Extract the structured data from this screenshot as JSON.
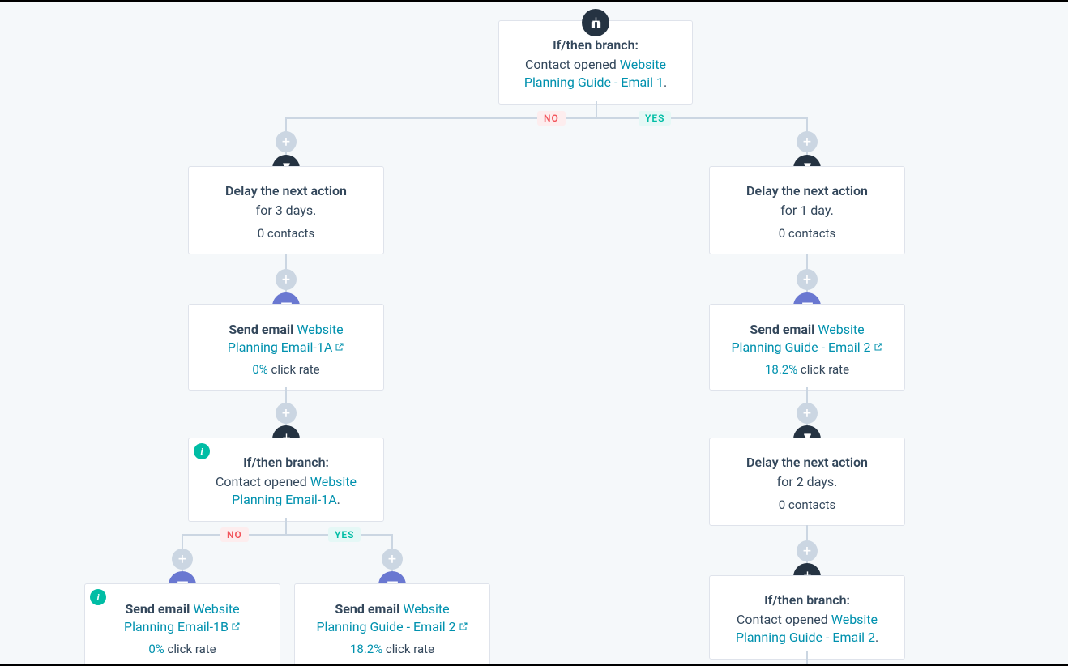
{
  "root_branch": {
    "title": "If/then branch:",
    "pre": "Contact opened ",
    "link": "Website Planning Guide - Email 1",
    "post": "."
  },
  "tag_no": "NO",
  "tag_yes": "YES",
  "left": {
    "delay": {
      "title": "Delay the next action",
      "body": "for 3 days.",
      "sub": "0 contacts"
    },
    "email": {
      "pre": "Send email ",
      "link": "Website Planning Email-1A",
      "pct": "0%",
      "rate_label": " click rate"
    },
    "branch": {
      "title": "If/then branch:",
      "pre": "Contact opened ",
      "link": "Website Planning Email-1A",
      "post": "."
    },
    "child_no": {
      "pre": "Send email ",
      "link": "Website Planning Email-1B",
      "pct": "0%",
      "rate_label": " click rate"
    },
    "child_yes": {
      "pre": "Send email ",
      "link": "Website Planning Guide - Email 2",
      "pct": "18.2%",
      "rate_label": " click rate"
    }
  },
  "right": {
    "delay1": {
      "title": "Delay the next action",
      "body": "for 1 day.",
      "sub": "0 contacts"
    },
    "email": {
      "pre": "Send email ",
      "link": "Website Planning Guide - Email 2",
      "pct": "18.2%",
      "rate_label": " click rate"
    },
    "delay2": {
      "title": "Delay the next action",
      "body": "for 2 days.",
      "sub": "0 contacts"
    },
    "branch": {
      "title": "If/then branch:",
      "pre": "Contact opened ",
      "link": "Website Planning Guide - Email 2",
      "post": "."
    }
  }
}
